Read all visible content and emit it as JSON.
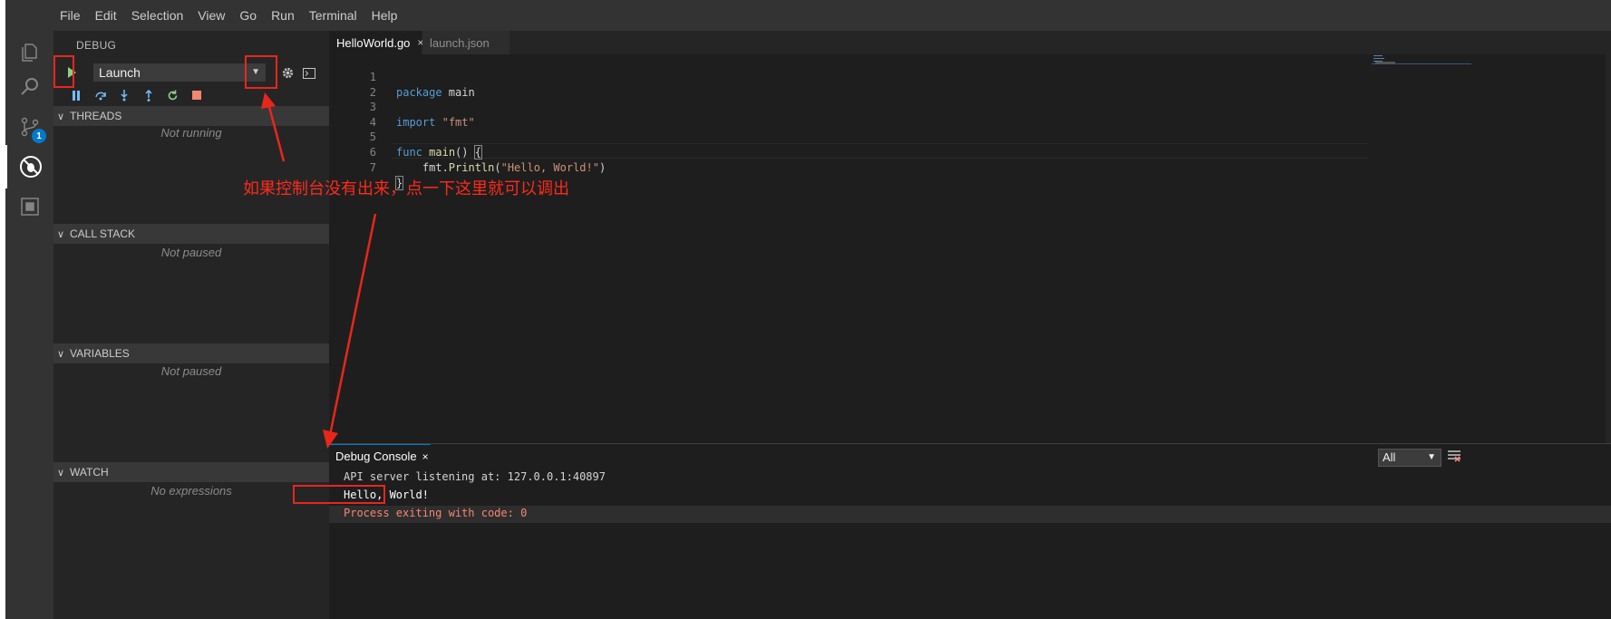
{
  "menu": [
    "File",
    "Edit",
    "Selection",
    "View",
    "Go",
    "Run",
    "Terminal",
    "Help"
  ],
  "activity_bar": {
    "icons": [
      "explorer-icon",
      "search-icon",
      "source-control-icon",
      "debug-icon",
      "extensions-icon"
    ],
    "scm_badge": "1"
  },
  "sidebar": {
    "title": "DEBUG",
    "config_value": "Launch",
    "sections": [
      {
        "label": "THREADS",
        "empty": "Not running"
      },
      {
        "label": "CALL STACK",
        "empty": "Not paused"
      },
      {
        "label": "VARIABLES",
        "empty": "Not paused"
      },
      {
        "label": "WATCH",
        "empty": "No expressions"
      }
    ]
  },
  "tabs": [
    {
      "label": "HelloWorld.go",
      "close": "×"
    },
    {
      "label": "launch.json"
    }
  ],
  "code_lines": [
    {
      "n": "1",
      "t": "package main"
    },
    {
      "n": "2",
      "t": ""
    },
    {
      "n": "3",
      "t": "import \"fmt\""
    },
    {
      "n": "4",
      "t": ""
    },
    {
      "n": "5",
      "t": "func main() {"
    },
    {
      "n": "6",
      "t": "    fmt.Println(\"Hello, World!\")"
    },
    {
      "n": "7",
      "t": "}"
    }
  ],
  "panel": {
    "tab_label": "Debug Console",
    "tab_close": "×",
    "filter": "All",
    "output": [
      "API server listening at: 127.0.0.1:40897",
      "Hello, World!",
      "Process exiting with code: 0"
    ]
  },
  "annotation": "如果控制台没有出来，点一下这里就可以调出",
  "colors": {
    "annotation_red": "#e8261c",
    "accent": "#007acc",
    "keyword": "#569cd6",
    "string": "#ce9178",
    "function": "#dcdcaa",
    "error_output": "#f48771"
  }
}
